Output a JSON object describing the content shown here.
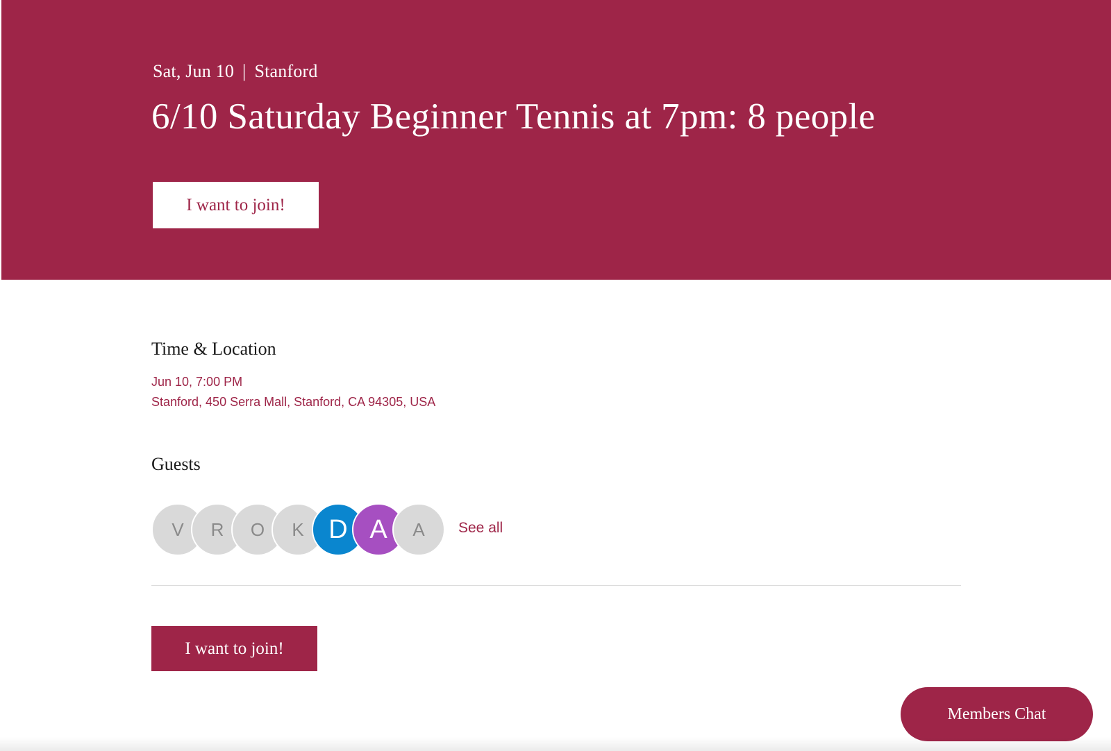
{
  "event": {
    "date_short": "Sat, Jun 10",
    "separator": "|",
    "city": "Stanford",
    "title": "6/10 Saturday Beginner Tennis at 7pm: 8 people"
  },
  "actions": {
    "join_label": "I want to join!",
    "see_all_label": "See all",
    "members_chat_label": "Members Chat"
  },
  "time_location": {
    "heading": "Time & Location",
    "datetime": "Jun 10, 7:00 PM",
    "address": "Stanford, 450 Serra Mall, Stanford, CA 94305, USA"
  },
  "guests": {
    "heading": "Guests",
    "avatars": [
      {
        "initial": "V",
        "color": "#d9d9d9",
        "text_color": "#8a8a8a"
      },
      {
        "initial": "R",
        "color": "#d9d9d9",
        "text_color": "#8a8a8a"
      },
      {
        "initial": "O",
        "color": "#d9d9d9",
        "text_color": "#8a8a8a"
      },
      {
        "initial": "K",
        "color": "#d9d9d9",
        "text_color": "#8a8a8a"
      },
      {
        "initial": "D",
        "color": "#0a86cf",
        "text_color": "#ffffff"
      },
      {
        "initial": "A",
        "color": "#a64fc1",
        "text_color": "#ffffff"
      },
      {
        "initial": "A",
        "color": "#d9d9d9",
        "text_color": "#8a8a8a"
      }
    ]
  },
  "theme": {
    "accent": "#9e2548",
    "background": "#ffffff",
    "divider": "#dcdcdc"
  }
}
